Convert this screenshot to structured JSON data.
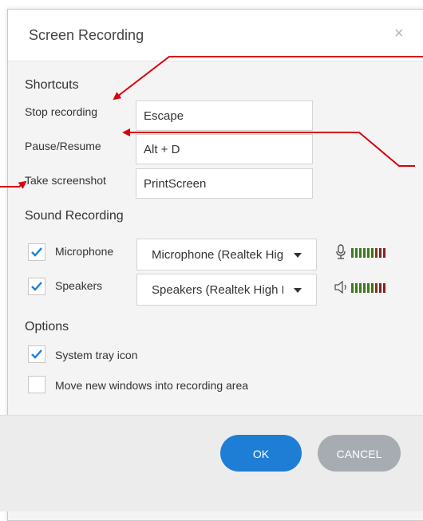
{
  "dialog": {
    "title": "Screen Recording",
    "close_glyph": "×"
  },
  "shortcuts": {
    "heading": "Shortcuts",
    "stop_label": "Stop recording",
    "stop_value": "Escape",
    "pause_label": "Pause/Resume",
    "pause_value": "Alt + D",
    "screenshot_label": "Take screenshot",
    "screenshot_value": "PrintScreen"
  },
  "sound": {
    "heading": "Sound Recording",
    "microphone": {
      "label": "Microphone",
      "checked": true,
      "device": "Microphone (Realtek High Definition Audio)",
      "icon": "microphone-icon"
    },
    "speakers": {
      "label": "Speakers",
      "checked": true,
      "device": "Speakers (Realtek High Definition Audio)",
      "icon": "speaker-icon"
    }
  },
  "options": {
    "heading": "Options",
    "system_tray": {
      "label": "System tray icon",
      "checked": true
    },
    "move_windows": {
      "label": "Move new windows into recording area",
      "checked": false
    }
  },
  "buttons": {
    "ok": "OK",
    "cancel": "CANCEL"
  },
  "colors": {
    "accent": "#1e7ed6",
    "cancel": "#a6acb2",
    "checkmark": "#1e7ed6",
    "annotation": "#d9000d",
    "meter_green": "#3e7a1e",
    "meter_red": "#8c1f1f"
  }
}
